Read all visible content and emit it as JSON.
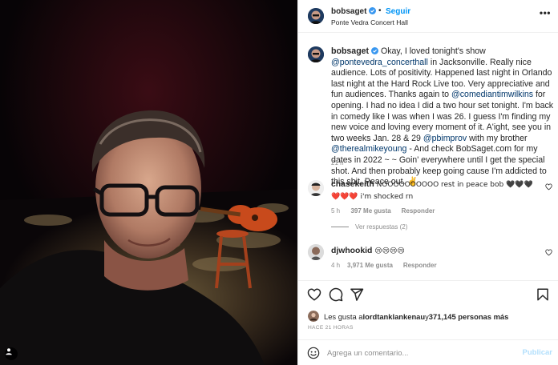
{
  "post": {
    "username": "bobsaget",
    "follow_label": "Seguir",
    "dot": "•",
    "location": "Ponte Vedra Concert Hall",
    "more": "•••"
  },
  "caption": {
    "username": "bobsaget",
    "part1": " Okay, I loved tonight's show ",
    "mention1": "@pontevedra_concerthall",
    "part2": " in Jacksonville. Really nice audience. Lots of positivity. Happened last night in Orlando last night at the Hard Rock Live too. Very appreciative and fun audiences. Thanks again to ",
    "mention2": "@comediantimwilkins",
    "part3": " for opening. I had no idea I did a two hour set tonight. I'm back in comedy like I was when I was 26. I guess I'm finding my new voice and loving every moment of it. A'ight, see you in two weeks Jan. 28 & 29 ",
    "mention3": "@pbimprov",
    "part4": " with my brother ",
    "mention4": "@therealmikeyoung",
    "part5": " - And check BobSaget.com for my dates in 2022 ~ ~ Goin' everywhere until I get the special shot. And then probably keep going cause I'm addicted to this shit. Peace out. ✌",
    "time": "21 h"
  },
  "comments": [
    {
      "username": "chasekeith",
      "text": " NOOOOOOOOOO rest in peace bob 🖤🖤🖤 ❤️❤️❤️ i'm shocked rn",
      "time": "5 h",
      "likes": "397 Me gusta",
      "reply": "Responder",
      "view_replies": "Ver respuestas (2)"
    },
    {
      "username": "djwhookid",
      "text": " 😢😢😢😢",
      "time": "4 h",
      "likes": "3,971 Me gusta",
      "reply": "Responder"
    }
  ],
  "likes_summary": {
    "prefix": "Les gusta a ",
    "user": "lordtanklankenau",
    "middle": " y ",
    "count": "371,145 personas más"
  },
  "time_ago": "HACE 21 HORAS",
  "composer": {
    "placeholder": "Agrega un comentario...",
    "publish": "Publicar"
  },
  "colors": {
    "accent": "#0095f6",
    "mention": "#00376b",
    "verified": "#3897f0",
    "heart": "#ed4956",
    "muted": "#8e8e8e"
  },
  "icons": [
    "user-tag-icon",
    "verified-badge-icon",
    "heart-icon",
    "comment-icon",
    "share-icon",
    "bookmark-icon",
    "emoji-icon"
  ]
}
